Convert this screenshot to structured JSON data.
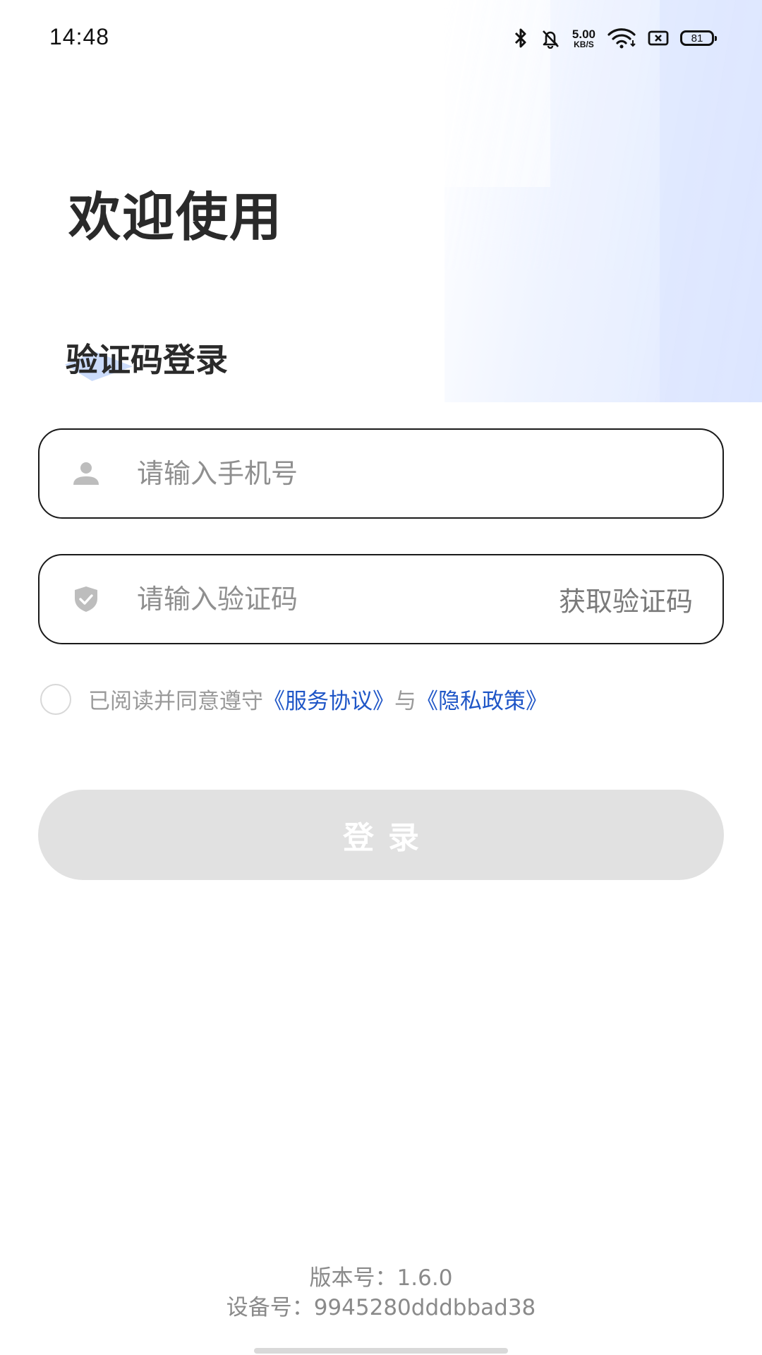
{
  "status_bar": {
    "time": "14:48",
    "net_speed_value": "5.00",
    "net_speed_unit": "KB/S",
    "battery_level": "81",
    "icons": [
      "bluetooth-icon",
      "bell-muted-icon",
      "wifi-icon",
      "sim-off-icon",
      "battery-icon"
    ]
  },
  "header": {
    "welcome": "欢迎使用",
    "login_type": "验证码登录"
  },
  "form": {
    "phone_placeholder": "请输入手机号",
    "phone_value": "",
    "code_placeholder": "请输入验证码",
    "code_value": "",
    "get_code_label": "获取验证码",
    "phone_icon": "user-icon",
    "code_icon": "shield-check-icon"
  },
  "agreement": {
    "prefix": "已阅读并同意遵守",
    "service_link": "《服务协议》",
    "connector": "与",
    "privacy_link": "《隐私政策》"
  },
  "login_button": {
    "label": "登录"
  },
  "footer": {
    "version": "版本号：1.6.0",
    "device": "设备号：9945280dddbbad38"
  },
  "colors": {
    "link": "#1f56c7",
    "button_disabled": "#e1e1e1",
    "border": "#1a1a1a",
    "accent_light": "#dce6ff"
  }
}
